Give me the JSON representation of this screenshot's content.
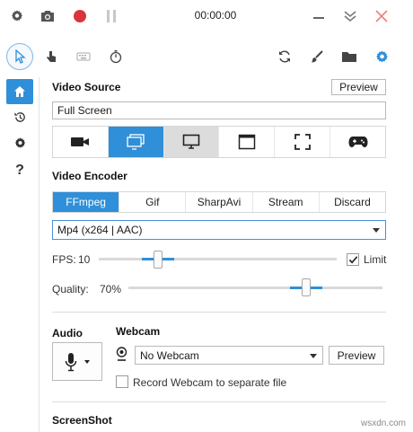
{
  "topbar": {
    "timer": "00:00:00",
    "icons": [
      "settings-gear-icon",
      "camera-icon",
      "record-icon",
      "pause-icon",
      "minimize-icon",
      "collapse-chevrons-icon",
      "close-icon"
    ],
    "colors": {
      "record": "#d9343b",
      "close": "#e8837f",
      "disabled": "#c8c8c8"
    }
  },
  "toolbar": {
    "icons": [
      "pointer-icon",
      "hand-click-icon",
      "keyboard-icon",
      "stopwatch-icon",
      "refresh-icon",
      "brush-icon",
      "folder-icon",
      "settings-gear-icon"
    ],
    "selected": "pointer-icon"
  },
  "sidebar": {
    "items": [
      {
        "icon": "home-icon",
        "selected": true
      },
      {
        "icon": "history-icon",
        "selected": false
      },
      {
        "icon": "settings-gear-icon",
        "selected": false
      },
      {
        "label": "?",
        "icon": "help-icon",
        "selected": false
      }
    ]
  },
  "video_source": {
    "title": "Video Source",
    "preview_label": "Preview",
    "value": "Full Screen",
    "sources": [
      "video-camera-icon",
      "screen-icon",
      "monitor-icon",
      "window-icon",
      "region-icon",
      "gamepad-icon"
    ],
    "active_source": "screen-icon"
  },
  "video_encoder": {
    "title": "Video Encoder",
    "tabs": [
      "FFmpeg",
      "Gif",
      "SharpAvi",
      "Stream",
      "Discard"
    ],
    "active_tab": "FFmpeg",
    "format": "Mp4 (x264 | AAC)",
    "fps_label": "FPS:",
    "fps_value": "10",
    "limit_label": "Limit",
    "limit_checked": true,
    "quality_label": "Quality:",
    "quality_value": "70%",
    "fps_fraction": 0.25,
    "quality_fraction": 0.7
  },
  "audio": {
    "title": "Audio"
  },
  "webcam": {
    "title": "Webcam",
    "value": "No Webcam",
    "preview_label": "Preview",
    "separate_file_label": "Record Webcam to separate file",
    "separate_file_checked": false
  },
  "screenshot": {
    "title": "ScreenShot"
  },
  "watermark": "wsxdn.com",
  "accent": "#2f8fd8"
}
